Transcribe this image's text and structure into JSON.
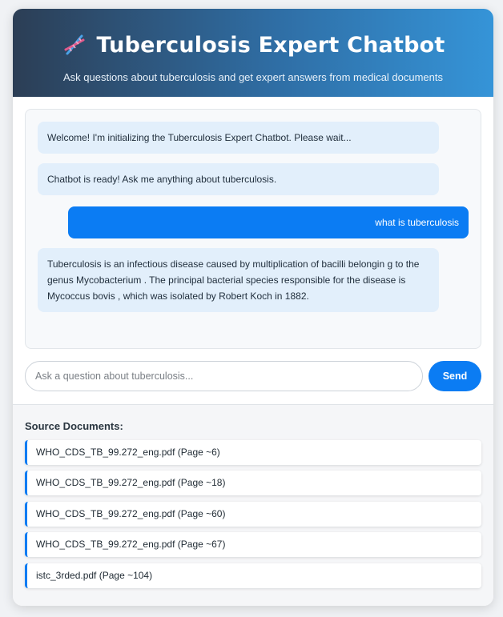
{
  "header": {
    "title": "Tuberculosis Expert Chatbot",
    "subtitle": "Ask questions about tuberculosis and get expert answers from medical documents",
    "icon": "dna-icon"
  },
  "chat": {
    "messages": [
      {
        "role": "bot",
        "text": "Welcome! I'm initializing the Tuberculosis Expert Chatbot. Please wait..."
      },
      {
        "role": "bot",
        "text": "Chatbot is ready! Ask me anything about tuberculosis."
      },
      {
        "role": "user",
        "text": "what is tuberculosis"
      },
      {
        "role": "bot",
        "text": "Tuberculosis is an infectious disease caused by multiplication of bacilli belongin g to the genus Mycobacterium . The principal bacterial species responsible for the disease is Mycoccus bovis , which was isolated by Robert Koch in 1882."
      }
    ]
  },
  "input": {
    "placeholder": "Ask a question about tuberculosis...",
    "value": "",
    "send_label": "Send"
  },
  "sources": {
    "title": "Source Documents:",
    "items": [
      "WHO_CDS_TB_99.272_eng.pdf (Page ~6)",
      "WHO_CDS_TB_99.272_eng.pdf (Page ~18)",
      "WHO_CDS_TB_99.272_eng.pdf (Page ~60)",
      "WHO_CDS_TB_99.272_eng.pdf (Page ~67)",
      "istc_3rded.pdf (Page ~104)"
    ]
  },
  "colors": {
    "accent": "#0b7cf3",
    "bot_bubble": "#e2effb",
    "header_start": "#2c3e55",
    "header_end": "#3594d8"
  }
}
